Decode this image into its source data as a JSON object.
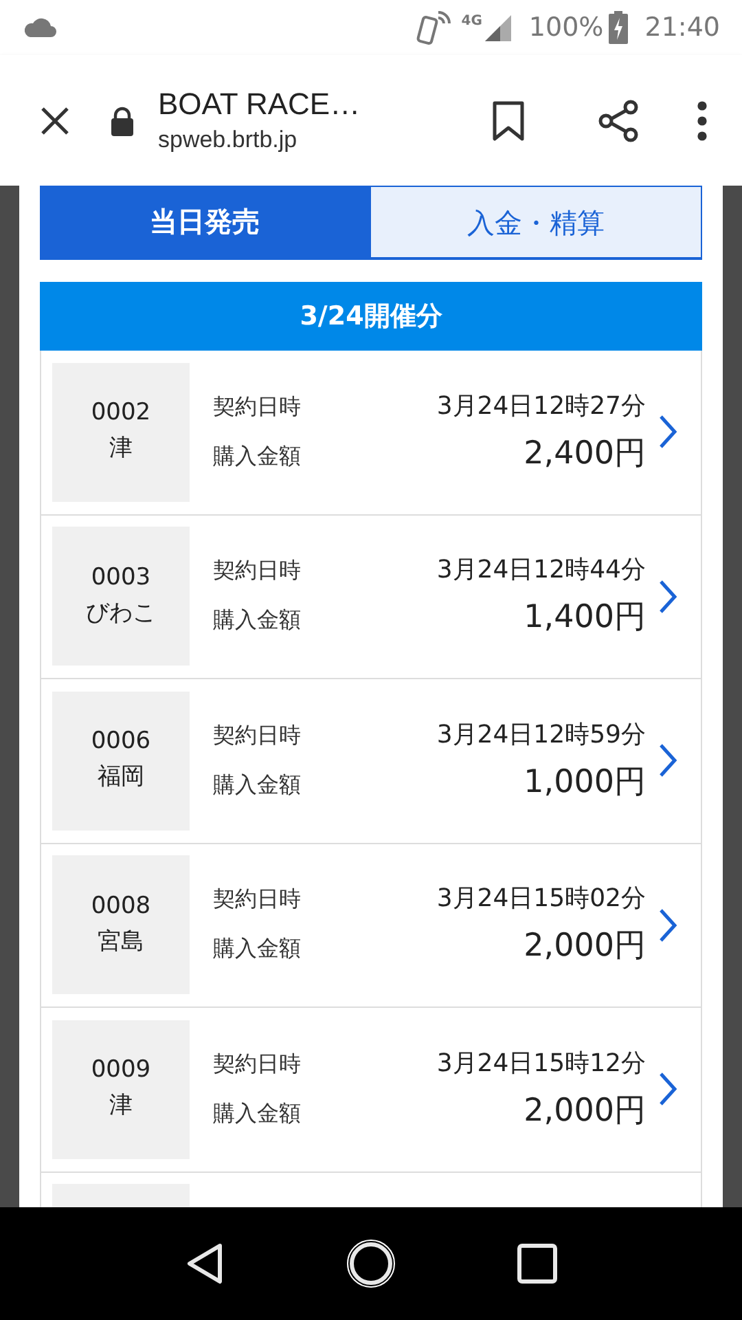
{
  "status_bar": {
    "battery": "100%",
    "network": "4G",
    "time": "21:40"
  },
  "browser": {
    "title": "BOAT RACE…",
    "url": "spweb.brtb.jp"
  },
  "tabs": [
    {
      "label": "当日発売",
      "selected": true
    },
    {
      "label": "入金・精算",
      "selected": false
    }
  ],
  "section_header": "3/24開催分",
  "purchases": [
    {
      "number": "0002",
      "venue": "津",
      "date_label": "契約日時",
      "date": "3月24日12時27分",
      "amount_label": "購入金額",
      "amount": "2,400円"
    },
    {
      "number": "0003",
      "venue": "びわこ",
      "date_label": "契約日時",
      "date": "3月24日12時44分",
      "amount_label": "購入金額",
      "amount": "1,400円"
    },
    {
      "number": "0006",
      "venue": "福岡",
      "date_label": "契約日時",
      "date": "3月24日12時59分",
      "amount_label": "購入金額",
      "amount": "1,000円"
    },
    {
      "number": "0008",
      "venue": "宮島",
      "date_label": "契約日時",
      "date": "3月24日15時02分",
      "amount_label": "購入金額",
      "amount": "2,000円"
    },
    {
      "number": "0009",
      "venue": "津",
      "date_label": "契約日時",
      "date": "3月24日15時12分",
      "amount_label": "購入金額",
      "amount": "2,000円"
    }
  ]
}
